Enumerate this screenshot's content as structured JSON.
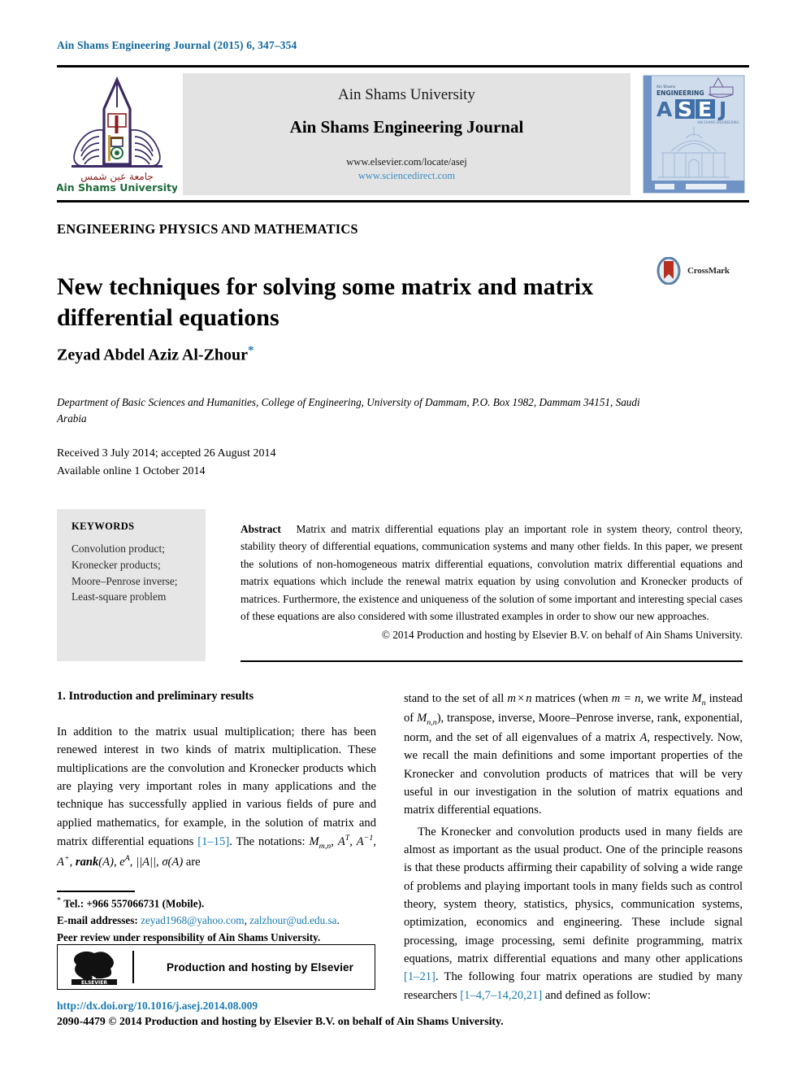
{
  "running_head": "Ain Shams Engineering Journal (2015) 6, 347–354",
  "masthead": {
    "university": "Ain Shams University",
    "journal": "Ain Shams Engineering Journal",
    "url_elsevier": "www.elsevier.com/locate/asej",
    "url_sciencedirect": "www.sciencedirect.com",
    "logo_caption_arabic": "جامعة عين شمس",
    "logo_caption": "Ain Shams University",
    "cover": {
      "top_small": "Ain Shams",
      "top_word": "ENGINEERING",
      "acronym_a": "A",
      "acronym_s": "S",
      "acronym_e": "E",
      "acronym_j": "J",
      "subtitle": "AIN SHAMS ENGINEERING"
    }
  },
  "kicker": "ENGINEERING PHYSICS AND MATHEMATICS",
  "title": "New techniques for solving some matrix and matrix differential equations",
  "crossmark": {
    "label": "CrossMark"
  },
  "author": {
    "name": "Zeyad Abdel Aziz Al-Zhour",
    "marker": "*"
  },
  "affiliation": "Department of Basic Sciences and Humanities, College of Engineering, University of Dammam, P.O. Box 1982, Dammam 34151, Saudi Arabia",
  "dates": {
    "received": "Received 3 July 2014; accepted 26 August 2014",
    "available": "Available online 1 October 2014"
  },
  "keywords": {
    "heading": "KEYWORDS",
    "items": [
      "Convolution product;",
      "Kronecker products;",
      "Moore–Penrose inverse;",
      "Least-square problem"
    ]
  },
  "abstract": {
    "label": "Abstract",
    "text": "Matrix and matrix differential equations play an important role in system theory, control theory, stability theory of differential equations, communication systems and many other fields. In this paper, we present the solutions of non-homogeneous matrix differential equations, convolution matrix differential equations and matrix equations which include the renewal matrix equation by using convolution and Kronecker products of matrices. Furthermore, the existence and uniqueness of the solution of some important and interesting special cases of these equations are also considered with some illustrated examples in order to show our new approaches.",
    "copyright": "© 2014 Production and hosting by Elsevier B.V. on behalf of Ain Shams University."
  },
  "body": {
    "section_heading": "1. Introduction and preliminary results",
    "left_paragraph_1_a": "In addition to the matrix usual multiplication; there has been renewed interest in two kinds of matrix multiplication. These multiplications are the convolution and Kronecker products which are playing very important roles in many applications and the technique has successfully applied in various fields of pure and applied mathematics, for example, in the solution of matrix and matrix differential equations ",
    "left_ref_1": "[1–15]",
    "left_paragraph_1_b": ". The notations: ",
    "notation_tail": " are",
    "right_paragraph_1_a": "stand to the set of all ",
    "right_paragraph_1_b": " matrices (when ",
    "right_paragraph_1_c": ", we write ",
    "right_paragraph_1_d": " instead of ",
    "right_paragraph_1_e": "), transpose, inverse, Moore–Penrose inverse, rank, exponential, norm, and the set of all eigenvalues of a matrix ",
    "right_paragraph_1_f": ", respectively. Now, we recall the main definitions and some important properties of the Kronecker and convolution products of matrices that will be very useful in our investigation in the solution of matrix equations and matrix differential equations.",
    "right_paragraph_2_a": "The Kronecker and convolution products used in many fields are almost as important as the usual product. One of the principle reasons is that these products affirming their capability of solving a wide range of problems and playing important tools in many fields such as control theory, system theory, statistics, physics, communication systems, optimization, economics and engineering. These include signal processing, image processing, semi definite programming, matrix equations, matrix differential equations and many other applications ",
    "right_ref_1": "[1–21]",
    "right_paragraph_2_b": ". The following four matrix operations are studied by many researchers ",
    "right_ref_2": "[1–4,7–14,20,21]",
    "right_paragraph_2_c": " and defined as follow:"
  },
  "footnotes": {
    "star": "*",
    "tel": "Tel.: +966 557066731 (Mobile).",
    "email_label": "E-mail addresses:",
    "email_1": "zeyad1968@yahoo.com",
    "email_sep": ", ",
    "email_2": "zalzhour@ud.edu.sa",
    "email_end": ".",
    "peer_review": "Peer review under responsibility of Ain Shams University."
  },
  "elsevier": {
    "logo_text": "ELSEVIER",
    "caption": "Production and hosting by Elsevier"
  },
  "footer": {
    "doi": "http://dx.doi.org/10.1016/j.asej.2014.08.009",
    "issn_line": "2090-4479 © 2014 Production and hosting by Elsevier B.V. on behalf of Ain Shams University."
  },
  "colors": {
    "link": "#1b7ab0",
    "runhead": "#10679b",
    "panel": "#e6e6e6",
    "masthead_band": "#e3e3e3",
    "crossmark_red": "#b7301f",
    "crossmark_blue": "#5b7fa6",
    "cover_blue": "#6e93c4"
  }
}
